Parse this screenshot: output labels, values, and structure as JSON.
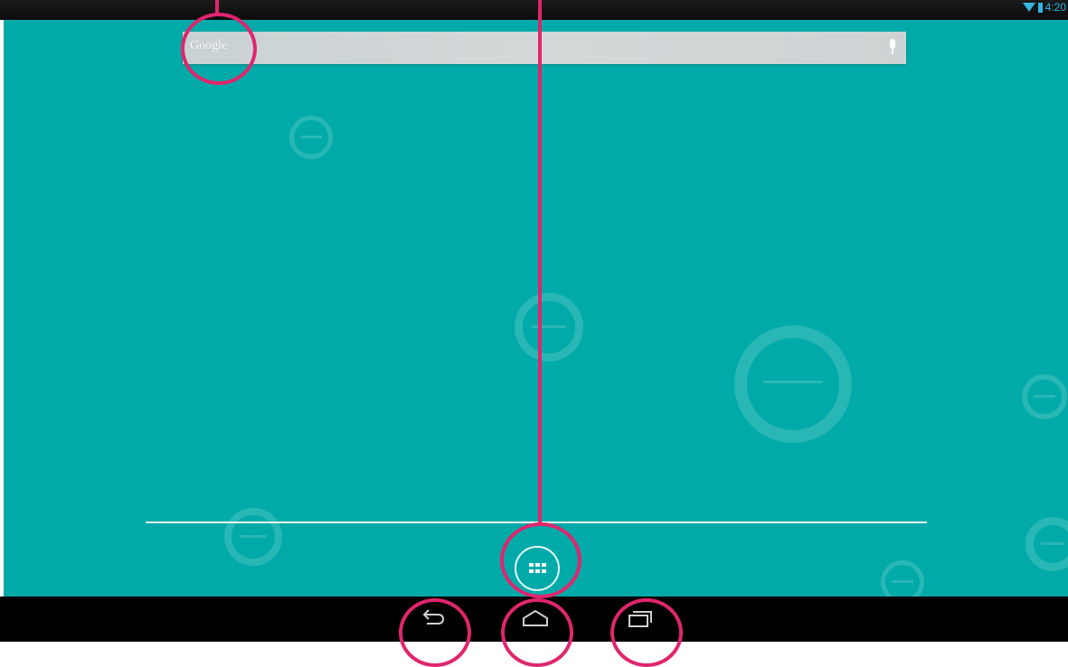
{
  "status_bar": {
    "clock": "4:20",
    "wifi_icon": "wifi-icon",
    "battery_icon": "battery-icon"
  },
  "search": {
    "logo_text": "Google",
    "mic_icon": "microphone-icon"
  },
  "dock": {
    "all_apps_icon": "apps-grid-icon"
  },
  "nav_bar": {
    "back_icon": "back-icon",
    "home_icon": "home-icon",
    "recents_icon": "recents-icon"
  },
  "colors": {
    "wallpaper": "#00aaa9",
    "annotation": "#e0256d",
    "status_accent": "#33b5e5"
  }
}
